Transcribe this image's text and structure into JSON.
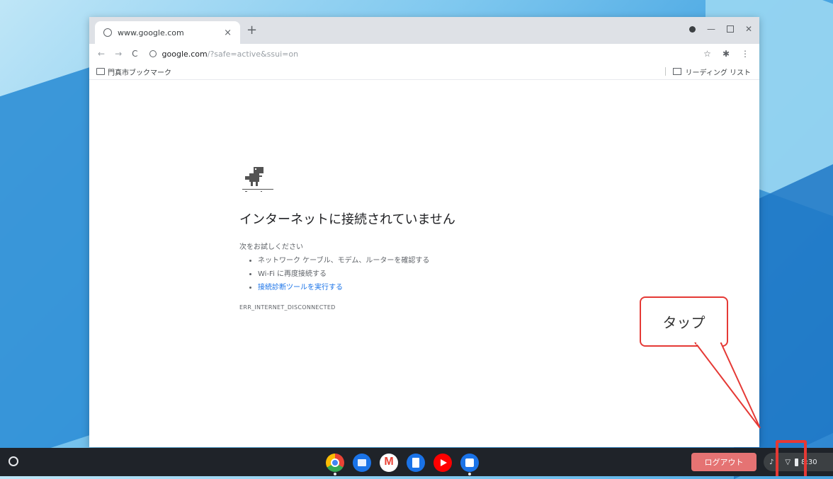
{
  "browser": {
    "tab_title": "www.google.com",
    "tab_close_glyph": "×",
    "new_tab_glyph": "+",
    "url_host": "google.com",
    "url_path": "/?safe=active&ssui=on",
    "bookmark_folder": "門真市ブックマーク",
    "reading_list": "リーディング リスト"
  },
  "error_page": {
    "title": "インターネットに接続されていません",
    "try_label": "次をお試しください",
    "suggestions": [
      "ネットワーク ケーブル、モデム、ルーターを確認する",
      "Wi-Fi に再度接続する",
      "接続診断ツールを実行する"
    ],
    "error_code": "ERR_INTERNET_DISCONNECTED"
  },
  "callout": {
    "text": "タップ"
  },
  "shelf": {
    "apps": [
      "chrome-icon",
      "files-icon",
      "gmail-icon",
      "docs-icon",
      "youtube-icon",
      "meet-icon"
    ],
    "logout_label": "ログアウト",
    "time": "8:30"
  },
  "colors": {
    "accent_red": "#e53935",
    "logout_bg": "#e57373",
    "link_blue": "#1a73e8"
  }
}
